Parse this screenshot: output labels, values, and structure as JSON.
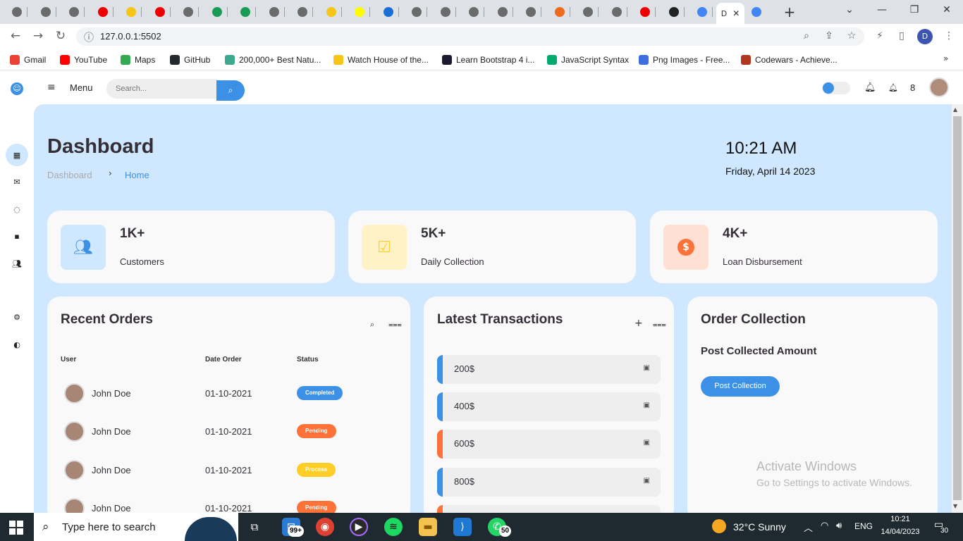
{
  "browser": {
    "active_tab_title": "D",
    "url": "127.0.0.1:5502",
    "profile_initial": "D",
    "bookmarks": [
      {
        "label": "Gmail",
        "color": "#ea4335"
      },
      {
        "label": "YouTube",
        "color": "#ff0000"
      },
      {
        "label": "Maps",
        "color": "#34a853"
      },
      {
        "label": "GitHub",
        "color": "#24292e"
      },
      {
        "label": "200,000+ Best Natu...",
        "color": "#3ba88f"
      },
      {
        "label": "Watch House of the...",
        "color": "#f5c518"
      },
      {
        "label": "Learn Bootstrap 4 i...",
        "color": "#1a1a2e"
      },
      {
        "label": "JavaScript Syntax",
        "color": "#04aa6d"
      },
      {
        "label": "Png Images - Free...",
        "color": "#3c6ee0"
      },
      {
        "label": "Codewars - Achieve...",
        "color": "#b1361e"
      }
    ]
  },
  "header": {
    "menu_label": "Menu",
    "search_placeholder": "Search...",
    "notification_count": "8"
  },
  "page": {
    "title": "Dashboard",
    "breadcrumb": [
      "Dashboard",
      "Home"
    ],
    "time": "10:21 AM",
    "date": "Friday, April 14 2023"
  },
  "stats": [
    {
      "value": "1K+",
      "label": "Customers",
      "icon": "users-icon",
      "bg": "#cfe8ff",
      "fg": "#3c91e6"
    },
    {
      "value": "5K+",
      "label": "Daily Collection",
      "icon": "calendar-check-icon",
      "bg": "#fff2c6",
      "fg": "#ffce26"
    },
    {
      "value": "4K+",
      "label": "Loan Disbursement",
      "icon": "dollar-circle-icon",
      "bg": "#ffe0d3",
      "fg": "#fd7238"
    }
  ],
  "orders": {
    "title": "Recent Orders",
    "columns": [
      "User",
      "Date Order",
      "Status"
    ],
    "rows": [
      {
        "user": "John Doe",
        "date": "01-10-2021",
        "status": "Completed",
        "color": "#3c91e6"
      },
      {
        "user": "John Doe",
        "date": "01-10-2021",
        "status": "Pending",
        "color": "#fd7238"
      },
      {
        "user": "John Doe",
        "date": "01-10-2021",
        "status": "Process",
        "color": "#ffce26"
      },
      {
        "user": "John Doe",
        "date": "01-10-2021",
        "status": "Pending",
        "color": "#fd7238"
      }
    ]
  },
  "transactions": {
    "title": "Latest Transactions",
    "items": [
      {
        "amount": "200$",
        "color": "#3c91e6"
      },
      {
        "amount": "400$",
        "color": "#3c91e6"
      },
      {
        "amount": "600$",
        "color": "#fd7238"
      },
      {
        "amount": "800$",
        "color": "#3c91e6"
      },
      {
        "amount": "",
        "color": "#fd7238"
      }
    ]
  },
  "collection": {
    "title": "Order Collection",
    "subtitle": "Post Collected Amount",
    "button": "Post Collection"
  },
  "watermark": {
    "line1": "Activate Windows",
    "line2": "Go to Settings to activate Windows."
  },
  "taskbar": {
    "search_placeholder": "Type here to search",
    "mail_badge": "99+",
    "whatsapp_badge": "50",
    "weather": "32°C  Sunny",
    "language": "ENG",
    "time": "10:21",
    "date": "14/04/2023",
    "notification_count": "30"
  },
  "colors": {
    "accent": "#3c91e6",
    "page_bg": "#cfe8ff",
    "card_bg": "#f9f9f9"
  }
}
